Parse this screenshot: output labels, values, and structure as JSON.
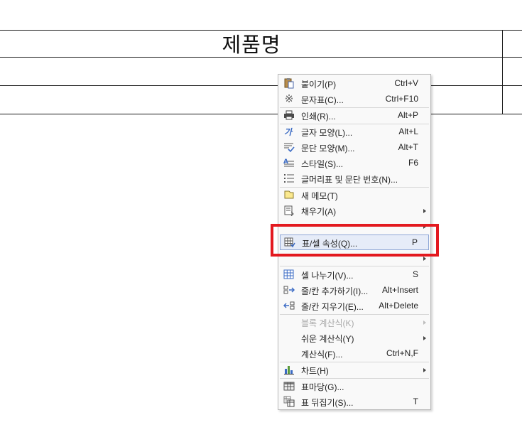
{
  "document": {
    "table_header": "제품명"
  },
  "context_menu": {
    "items": [
      {
        "label": "붙이기(P)",
        "shortcut": "Ctrl+V",
        "icon": "paste-icon"
      },
      {
        "label": "문자표(C)...",
        "shortcut": "Ctrl+F10",
        "icon": "symbol-icon"
      },
      {
        "label": "인쇄(R)...",
        "shortcut": "Alt+P",
        "icon": "print-icon"
      },
      {
        "label": "글자 모양(L)...",
        "shortcut": "Alt+L",
        "icon": "char-shape-icon"
      },
      {
        "label": "문단 모양(M)...",
        "shortcut": "Alt+T",
        "icon": "paragraph-shape-icon"
      },
      {
        "label": "스타일(S)...",
        "shortcut": "F6",
        "icon": "style-icon"
      },
      {
        "label": "글머리표 및 문단 번호(N)...",
        "shortcut": "",
        "icon": "bullet-numbering-icon"
      },
      {
        "label": "새 메모(T)",
        "shortcut": "",
        "icon": "new-memo-icon"
      },
      {
        "label": "채우기(A)",
        "shortcut": "",
        "icon": "fill-icon",
        "submenu": true
      },
      {
        "label": "표/셀 속성(Q)...",
        "shortcut": "P",
        "icon": "table-cell-properties-icon",
        "highlighted": true
      },
      {
        "label": "셀 나누기(V)...",
        "shortcut": "S",
        "icon": "split-cell-icon"
      },
      {
        "label": "줄/칸 추가하기(I)...",
        "shortcut": "Alt+Insert",
        "icon": "insert-row-col-icon"
      },
      {
        "label": "줄/칸 지우기(E)...",
        "shortcut": "Alt+Delete",
        "icon": "delete-row-col-icon"
      },
      {
        "label": "블록 계산식(K)",
        "shortcut": "",
        "icon": "",
        "disabled": true,
        "submenu": true
      },
      {
        "label": "쉬운 계산식(Y)",
        "shortcut": "",
        "icon": "",
        "submenu": true
      },
      {
        "label": "계산식(F)...",
        "shortcut": "Ctrl+N,F",
        "icon": ""
      },
      {
        "label": "차트(H)",
        "shortcut": "",
        "icon": "chart-icon",
        "submenu": true
      },
      {
        "label": "표마당(G)...",
        "shortcut": "",
        "icon": "table-template-icon"
      },
      {
        "label": "표 뒤집기(S)...",
        "shortcut": "T",
        "icon": "flip-table-icon"
      }
    ]
  },
  "annotation": {
    "highlight_color": "#e3191f",
    "target": "표/셀 속성(Q)..."
  }
}
